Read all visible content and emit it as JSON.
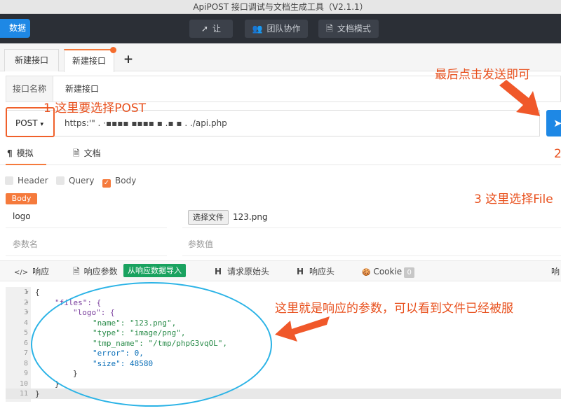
{
  "window": {
    "title": "ApiPOST 接口调试与文档生成工具（V2.1.1）"
  },
  "topbar": {
    "sync_label": "数据",
    "buttons": [
      {
        "icon": "send-icon",
        "label": "让"
      },
      {
        "icon": "team-icon",
        "label": "团队协作"
      },
      {
        "icon": "document-icon",
        "label": "文档模式"
      }
    ]
  },
  "tabs": [
    {
      "label": "新建接口",
      "active": false
    },
    {
      "label": "新建接口",
      "active": true,
      "unsaved": true
    }
  ],
  "tab_add": "+",
  "request": {
    "name_label": "接口名称",
    "name_value": "新建接口",
    "method": "POST",
    "url": "https:'\"  .  ·▪▪▪▪ ▪▪▪▪  ▪  .▪ ▪ .  ./api.php"
  },
  "subtabs": [
    {
      "icon": "¶",
      "label": "模拟",
      "active": true
    },
    {
      "icon": "🗎",
      "label": "文档",
      "active": false
    }
  ],
  "param_types": [
    {
      "label": "Header",
      "checked": false
    },
    {
      "label": "Query",
      "checked": false
    },
    {
      "label": "Body",
      "checked": true
    }
  ],
  "body": {
    "badge": "Body",
    "rows": [
      {
        "key": "logo",
        "file_button": "选择文件",
        "file_name": "123.png"
      }
    ],
    "key_placeholder": "参数名",
    "value_placeholder": "参数值"
  },
  "response_tabs": [
    {
      "icon": "</>",
      "label": "响应"
    },
    {
      "icon": "🗎",
      "label": "响应参数"
    },
    {
      "label": "从响应数据导入"
    },
    {
      "icon": "H",
      "label": "请求原始头"
    },
    {
      "icon": "H",
      "label": "响应头"
    },
    {
      "icon": "🍪",
      "label": "Cookie",
      "count": "0"
    },
    {
      "label": "响"
    }
  ],
  "response_code": {
    "line_numbers": [
      "1",
      "2",
      "3",
      "4",
      "5",
      "6",
      "7",
      "8",
      "9",
      "10",
      "11"
    ],
    "folds": [
      "▾",
      "▾",
      "▾"
    ],
    "lines": [
      "{",
      "\"files\": {",
      "\"logo\": {",
      "\"name\": \"123.png\",",
      "\"type\": \"image/png\",",
      "\"tmp_name\": \"/tmp/phpG3vqOL\",",
      "\"error\": 0,",
      "\"size\": 48580",
      "}",
      "}",
      "}"
    ]
  },
  "annotations": {
    "step1": "1 这里要选择POST",
    "send_hint": "最后点击发送即可",
    "step2": "2",
    "step3": "3 这里选择File",
    "response_note": "这里就是响应的参数，可以看到文件已经被服"
  },
  "colors": {
    "accent": "#f57a3c",
    "primary": "#1e88e5",
    "annotation": "#e8501d",
    "highlight": "#2bb3e6"
  }
}
